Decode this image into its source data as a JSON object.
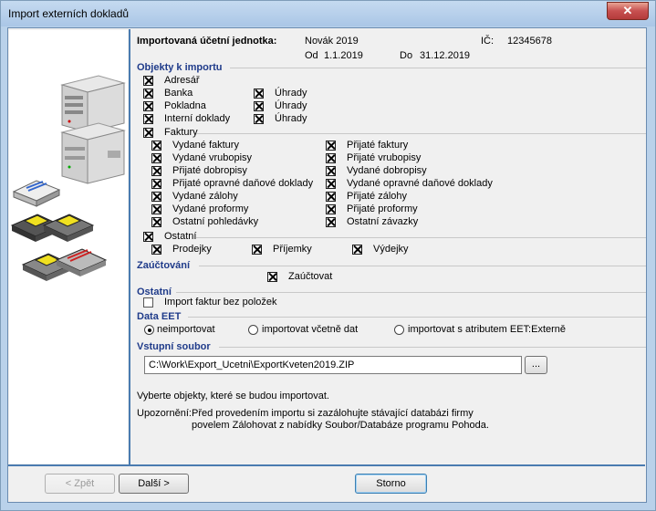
{
  "window": {
    "title": "Import externích dokladů",
    "close_glyph": "✕"
  },
  "header": {
    "unit_label": "Importovaná účetní jednotka:",
    "unit_name": "Novák 2019",
    "ic_label": "IČ:",
    "ic_value": "12345678",
    "from_label": "Od",
    "from_value": "1.1.2019",
    "to_label": "Do",
    "to_value": "31.12.2019"
  },
  "objects": {
    "title": "Objekty k importu",
    "adresar": "Adresář",
    "banka": "Banka",
    "pokladna": "Pokladna",
    "interni": "Interní doklady",
    "uhrady": "Úhrady",
    "faktury": "Faktury",
    "faktury_left": [
      "Vydané faktury",
      "Vydané vrubopisy",
      "Přijaté dobropisy",
      "Přijaté opravné daňové doklady",
      "Vydané zálohy",
      "Vydané proformy",
      "Ostatní pohledávky"
    ],
    "faktury_right": [
      "Přijaté faktury",
      "Přijaté vrubopisy",
      "Vydané dobropisy",
      "Vydané opravné daňové doklady",
      "Přijaté zálohy",
      "Přijaté proformy",
      "Ostatní závazky"
    ],
    "ostatni": "Ostatní",
    "prodejky": "Prodejky",
    "prijemky": "Příjemky",
    "vydejky": "Výdejky"
  },
  "zauctovani": {
    "title": "Zaúčtování",
    "checkbox": "Zaúčtovat"
  },
  "ostatni_sec": {
    "title": "Ostatní",
    "checkbox": "Import faktur bez položek"
  },
  "eet": {
    "title": "Data EET",
    "options": [
      "neimportovat",
      "importovat včetně dat",
      "importovat s atributem EET:Externě"
    ],
    "selected": "neimportovat"
  },
  "file": {
    "title": "Vstupní soubor",
    "path": "C:\\Work\\Export_Ucetni\\ExportKveten2019.ZIP",
    "browse": "..."
  },
  "info": {
    "hint": "Vyberte objekty, které se budou importovat.",
    "warn_label": "Upozornění:",
    "warn_line1": "Před provedením importu si zazálohujte stávající databázi firmy",
    "warn_line2": "povelem Zálohovat z nabídky Soubor/Databáze programu Pohoda."
  },
  "buttons": {
    "back": "< Zpět",
    "next": "Další >",
    "cancel": "Storno"
  },
  "icons": [
    "computer-illustration",
    "disk-red-icon",
    "floppy-yellow-icon",
    "floppy-gray-icon"
  ]
}
